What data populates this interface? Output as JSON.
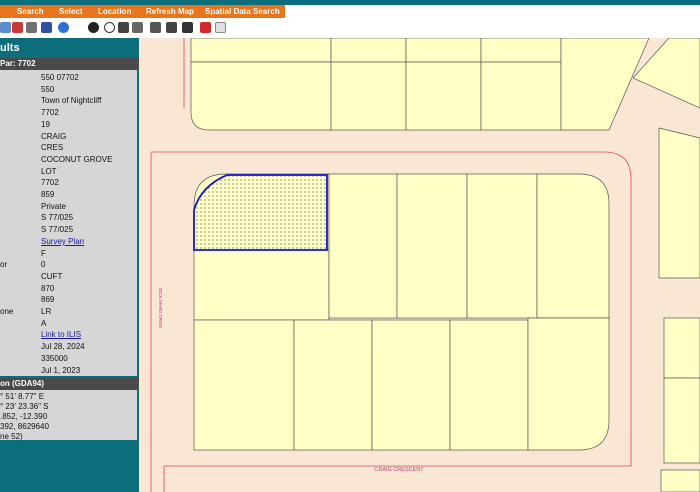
{
  "menu": [
    "Search",
    "Select",
    "Location",
    "Refresh Map",
    "Spatial Data Search"
  ],
  "toolbar": {
    "icons": [
      "zoom-in-icon",
      "zoom-out-icon",
      "print-icon",
      "save-icon",
      "info-icon",
      "identify-icon",
      "info-alt-icon",
      "measure-icon",
      "pan-icon",
      "full-extent-icon",
      "bookmark-icon",
      "layers-icon",
      "clear-selection-icon",
      "eraser-icon"
    ]
  },
  "panel": {
    "title": "ults",
    "section_header": "Par: 7702",
    "properties": [
      {
        "key": "",
        "value": "550    07702"
      },
      {
        "key": "",
        "value": "550"
      },
      {
        "key": "",
        "value": "Town of Nightcliff"
      },
      {
        "key": "",
        "value": "7702"
      },
      {
        "key": "",
        "value": "19"
      },
      {
        "key": "",
        "value": "CRAIG"
      },
      {
        "key": "",
        "value": "CRES"
      },
      {
        "key": "",
        "value": "COCONUT GROVE"
      },
      {
        "key": "",
        "value": "LOT"
      },
      {
        "key": "",
        "value": "7702"
      },
      {
        "key": "",
        "value": "859"
      },
      {
        "key": "",
        "value": "Private"
      },
      {
        "key": "",
        "value": "S 77/025"
      },
      {
        "key": "",
        "value": "S 77/025"
      },
      {
        "key": "",
        "value": "Survey Plan",
        "link": true
      },
      {
        "key": "",
        "value": "F"
      },
      {
        "key": "or",
        "value": "0"
      },
      {
        "key": "",
        "value": "CUFT"
      },
      {
        "key": "",
        "value": "870"
      },
      {
        "key": "",
        "value": "869"
      },
      {
        "key": "one",
        "value": "LR"
      },
      {
        "key": "",
        "value": "A"
      },
      {
        "key": "",
        "value": "Link to ILIS",
        "link": true
      },
      {
        "key": "",
        "value": "Jul 28, 2024"
      },
      {
        "key": "",
        "value": "335000"
      },
      {
        "key": "",
        "value": "Jul 1, 2023"
      }
    ],
    "coords_header": "on (GDA94)",
    "coords": [
      "° 51' 8.77\" E",
      "° 23' 23.36\" S",
      ".852, -12.390",
      "392, 8629640",
      "ne 52)"
    ]
  },
  "map": {
    "street_labels": [
      "CRAIG CRESCENT",
      "DICK WARD DRIVE"
    ],
    "colors": {
      "road": "#f9e7d4",
      "lot": "#ffffc6",
      "boundary": "#d9475f",
      "selection": "#1616d0"
    }
  }
}
